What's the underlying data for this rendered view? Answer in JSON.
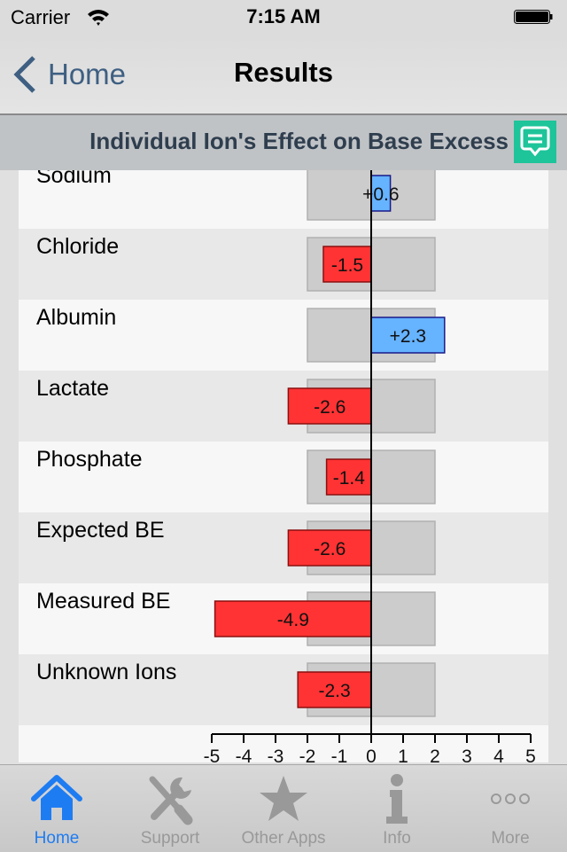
{
  "status_bar": {
    "carrier": "Carrier",
    "time": "7:15 AM"
  },
  "nav": {
    "back_label": "Home",
    "title": "Results"
  },
  "section": {
    "title": "Individual Ion's Effect on Base Excess",
    "comment_icon": "comment-icon"
  },
  "colors": {
    "negative": "#ff3333",
    "positive": "#66b3ff",
    "range": "#cccccc",
    "accent": "#1e7cf2",
    "comment": "#1ec49a"
  },
  "chart_data": {
    "type": "bar",
    "orientation": "horizontal",
    "title": "Individual Ion's Effect on Base Excess",
    "categories": [
      "Sodium",
      "Chloride",
      "Albumin",
      "Lactate",
      "Phosphate",
      "Expected BE",
      "Measured BE",
      "Unknown Ions"
    ],
    "values": [
      0.6,
      -1.5,
      2.3,
      -2.6,
      -1.4,
      -2.6,
      -4.9,
      -2.3
    ],
    "value_labels": [
      "+0.6",
      "-1.5",
      "+2.3",
      "-2.6",
      "-1.4",
      "-2.6",
      "-4.9",
      "-2.3"
    ],
    "normal_range": [
      -2,
      2
    ],
    "xlim": [
      -5,
      5
    ],
    "x_ticks": [
      "-5",
      "-4",
      "-3",
      "-2",
      "-1",
      "0",
      "1",
      "2",
      "3",
      "4",
      "5"
    ],
    "xlabel": "",
    "ylabel": "",
    "grid": false
  },
  "tabs": [
    {
      "label": "Home",
      "icon": "home-icon",
      "active": true
    },
    {
      "label": "Support",
      "icon": "tools-icon",
      "active": false
    },
    {
      "label": "Other Apps",
      "icon": "star-icon",
      "active": false
    },
    {
      "label": "Info",
      "icon": "info-icon",
      "active": false
    },
    {
      "label": "More",
      "icon": "more-icon",
      "active": false
    }
  ]
}
